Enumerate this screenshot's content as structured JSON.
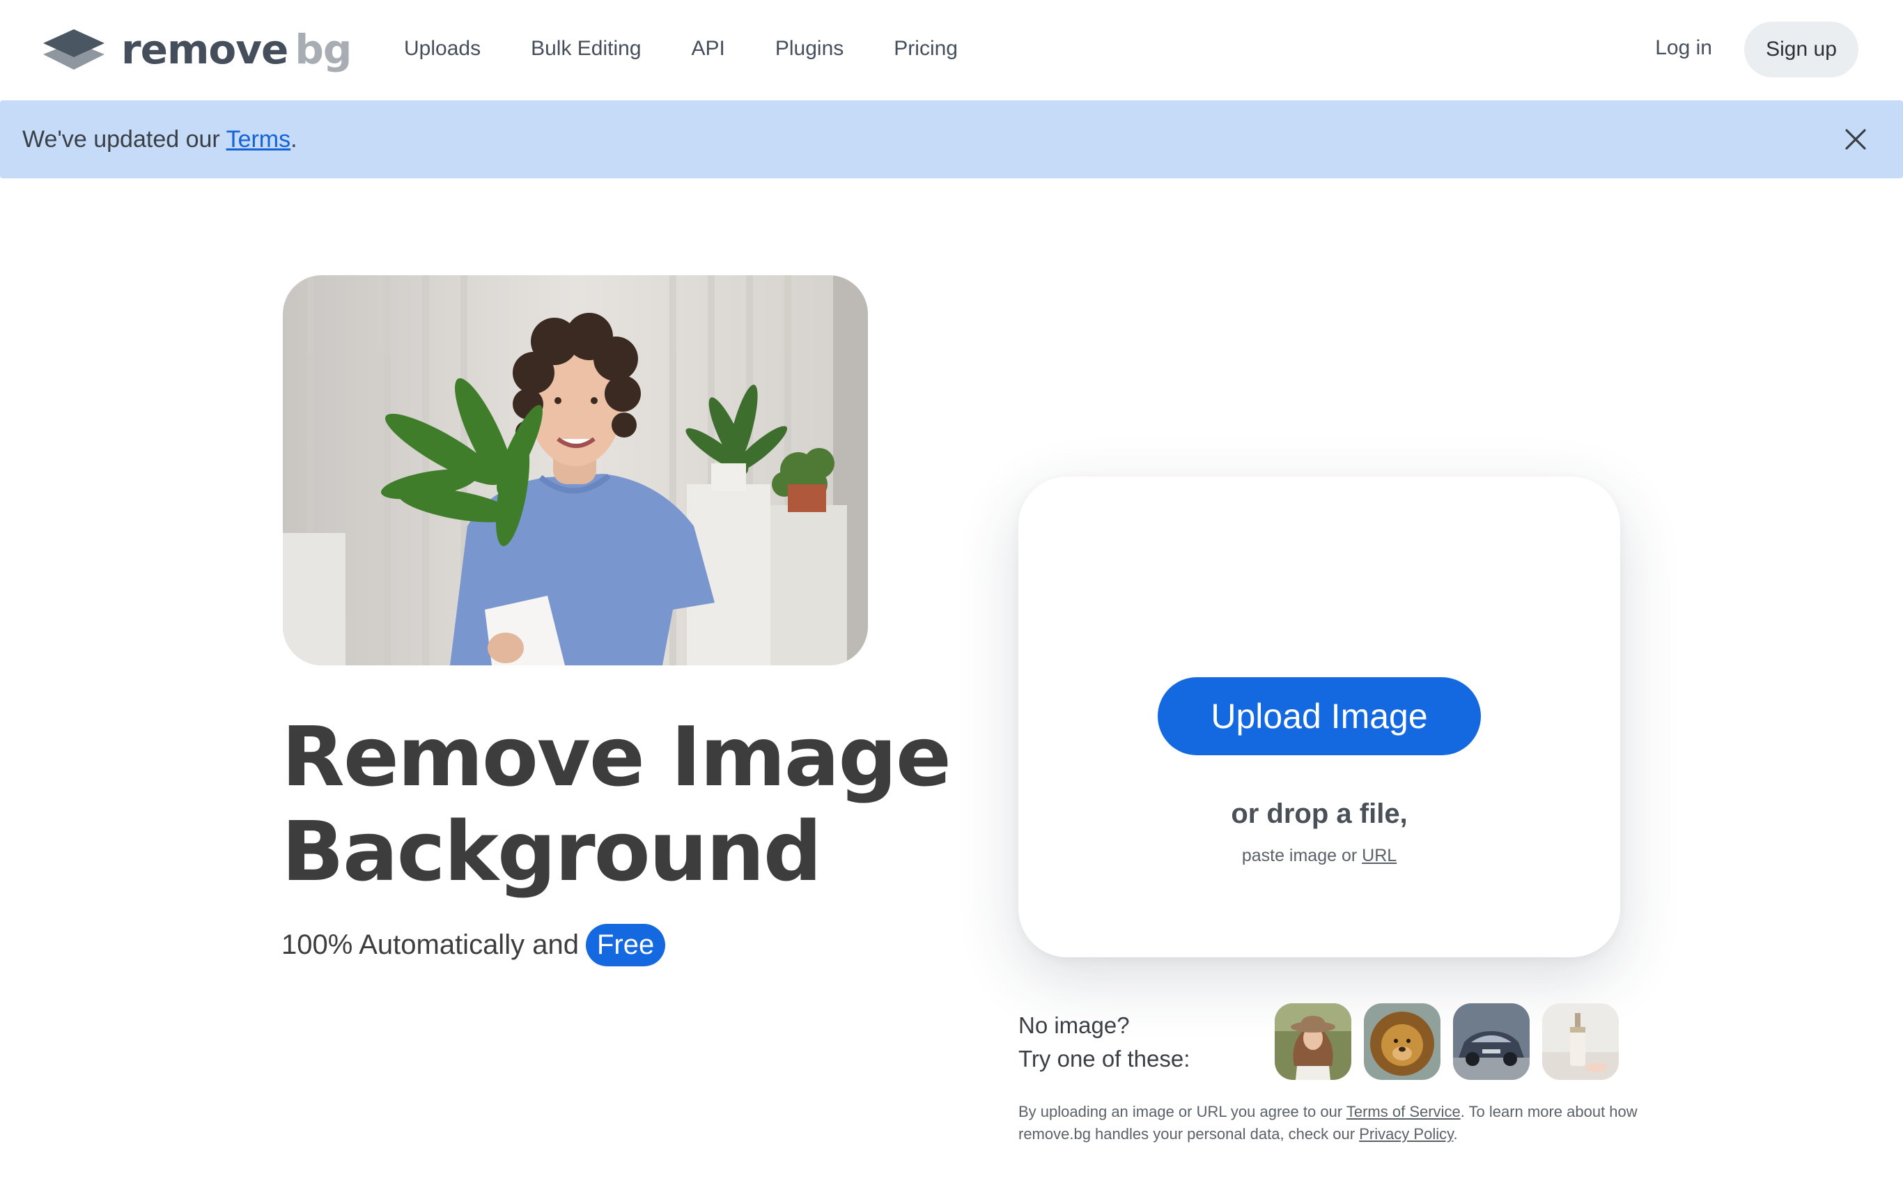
{
  "brand": {
    "name_part1": "remove",
    "name_part2": "bg"
  },
  "nav": {
    "items": [
      {
        "label": "Uploads"
      },
      {
        "label": "Bulk Editing"
      },
      {
        "label": "API"
      },
      {
        "label": "Plugins"
      },
      {
        "label": "Pricing"
      }
    ],
    "login_label": "Log in",
    "signup_label": "Sign up"
  },
  "banner": {
    "text_before": "We've updated our ",
    "link_label": "Terms",
    "text_after": "."
  },
  "hero": {
    "title_line1": "Remove Image",
    "title_line2": "Background",
    "subtitle": "100% Automatically and",
    "free_label": "Free"
  },
  "upload": {
    "button_label": "Upload Image",
    "drop_text": "or drop a file,",
    "paste_text": "paste image or ",
    "url_label": "URL"
  },
  "samples": {
    "line1": "No image?",
    "line2": "Try one of these:",
    "items": [
      "woman-with-hat",
      "lion",
      "car",
      "cosmetic-bottle"
    ]
  },
  "legal": {
    "part1": "By uploading an image or URL you agree to our ",
    "tos_label": "Terms of Service",
    "part2": ". To learn more about how remove.bg handles your personal data, check our ",
    "privacy_label": "Privacy Policy",
    "part3": "."
  },
  "colors": {
    "accent": "#1569e0",
    "banner_bg": "#c6dbf7",
    "text": "#3d3d3d"
  }
}
